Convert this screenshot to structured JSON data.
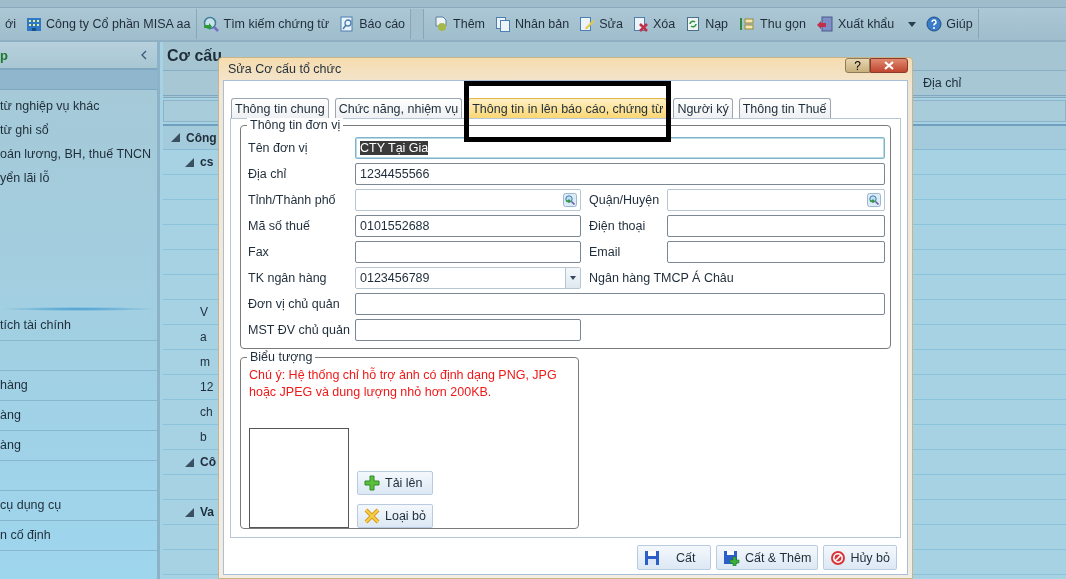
{
  "toolbar": {
    "groups": [
      {
        "items": [
          {
            "label": "ới"
          },
          {
            "label": "Công ty Cổ phần MISA aa"
          }
        ]
      },
      {
        "items": [
          {
            "label": "Tìm kiếm chứng từ"
          },
          {
            "label": "Báo cáo"
          }
        ]
      },
      {
        "items": [
          {
            "label": "Thêm"
          },
          {
            "label": "Nhân bản"
          },
          {
            "label": "Sửa"
          },
          {
            "label": "Xóa"
          },
          {
            "label": "Nạp"
          },
          {
            "label": "Thu gọn"
          },
          {
            "label": "Xuất khẩu",
            "has_menu": true
          },
          {
            "label": "Giúp"
          }
        ]
      }
    ]
  },
  "sidebar": {
    "title": "p",
    "items": [
      "từ nghiệp vụ khác",
      "từ ghi sổ",
      "oán lương, BH, thuế TNCN",
      "yển lãi lỗ"
    ],
    "sections": [
      {
        "kind": "label",
        "label": "tích tài chính"
      },
      {
        "kind": "blank"
      },
      {
        "kind": "label",
        "label": "hàng"
      },
      {
        "kind": "label",
        "label": "àng"
      },
      {
        "kind": "label",
        "label": "àng"
      },
      {
        "kind": "blank"
      },
      {
        "kind": "label",
        "label": "cụ dụng cụ"
      },
      {
        "kind": "label",
        "label": "n cố định"
      },
      {
        "kind": "blank"
      }
    ]
  },
  "main": {
    "title": "Cơ cấu",
    "column_header": "Địa chỉ",
    "grid_header": "Công",
    "rows": [
      {
        "kind": "group",
        "text": "cs"
      },
      {
        "kind": "blank"
      },
      {
        "kind": "blank"
      },
      {
        "kind": "blank"
      },
      {
        "kind": "blank"
      },
      {
        "kind": "blank"
      },
      {
        "kind": "item",
        "text": "V"
      },
      {
        "kind": "item",
        "text": "a"
      },
      {
        "kind": "item",
        "text": "m"
      },
      {
        "kind": "item",
        "text": "12"
      },
      {
        "kind": "item",
        "text": "ch"
      },
      {
        "kind": "item",
        "text": "b"
      },
      {
        "kind": "group",
        "text": "Cô"
      },
      {
        "kind": "blank"
      },
      {
        "kind": "group",
        "text": "Va"
      },
      {
        "kind": "blank"
      },
      {
        "kind": "blank"
      }
    ]
  },
  "dialog": {
    "title": "Sửa Cơ cấu tổ chức",
    "help": "?",
    "tabs": [
      {
        "label": "Thông tin chung",
        "selected": false
      },
      {
        "label": "Chức năng, nhiệm vụ",
        "selected": false
      },
      {
        "label": "Thông tin in lên báo cáo, chứng từ",
        "selected": true
      },
      {
        "label": "Người ký",
        "selected": false
      },
      {
        "label": "Thông tin Thuế",
        "selected": false
      }
    ],
    "unit_info": {
      "legend": "Thông tin đơn vị",
      "fields": [
        {
          "kind": "wide",
          "label": "Tên đơn vị",
          "value": "CTY Tại Gia",
          "text_selected": true
        },
        {
          "kind": "wide",
          "label": "Địa chỉ",
          "value": "1234455566"
        },
        {
          "kind": "lookup",
          "label": "Tỉnh/Thành phố"
        },
        {
          "kind": "lookup",
          "label": "Quận/Huyện"
        },
        {
          "kind": "text",
          "label": "Mã số thuế",
          "value": "0101552688"
        },
        {
          "kind": "text",
          "label": "Điện thoại"
        },
        {
          "kind": "text",
          "label": "Fax"
        },
        {
          "kind": "text",
          "label": "Email"
        },
        {
          "kind": "combo",
          "label": "TK ngân hàng",
          "value": "0123456789"
        },
        {
          "kind": "note",
          "text": "Ngân hàng TMCP Á Châu"
        },
        {
          "kind": "wide",
          "label": "Đơn vị chủ quản"
        },
        {
          "kind": "text",
          "label": "MST ĐV chủ quản"
        }
      ]
    },
    "logo": {
      "legend": "Biểu tượng",
      "note": "Chú ý: Hệ thống chỉ hỗ trợ ảnh có định dạng PNG, JPG hoặc JPEG và dung lượng nhỏ hơn 200KB.",
      "upload": "Tải lên",
      "remove": "Loại bỏ"
    },
    "buttons": [
      "Cất",
      "Cất & Thêm",
      "Hủy bỏ"
    ]
  }
}
